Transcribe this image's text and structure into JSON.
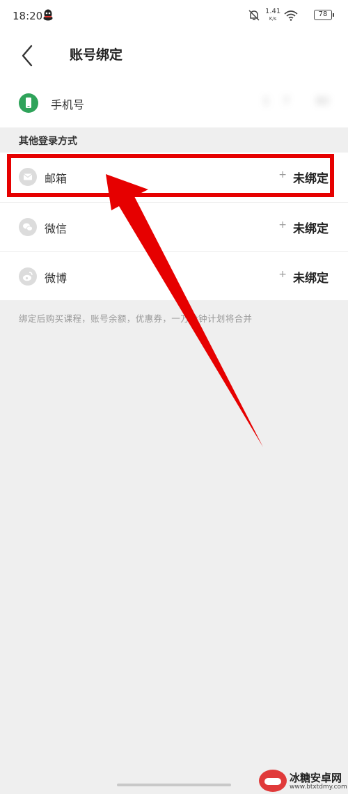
{
  "status_bar": {
    "time": "18:20",
    "net_speed": "1.41",
    "net_unit": "K/s",
    "battery": "78"
  },
  "header": {
    "title": "账号绑定"
  },
  "phone": {
    "label": "手机号",
    "value": "1    7        80"
  },
  "section": {
    "title": "其他登录方式"
  },
  "accounts": [
    {
      "label": "邮箱",
      "plus": "+",
      "status": "未绑定"
    },
    {
      "label": "微信",
      "plus": "+",
      "status": "未绑定"
    },
    {
      "label": "微博",
      "plus": "+",
      "status": "未绑定"
    }
  ],
  "note": "绑定后购买课程，账号余额，优惠券，一万分钟计划将合并",
  "watermark": {
    "title": "冰糖安卓网",
    "url": "www.btxtdmy.com"
  },
  "colors": {
    "highlight": "#e60000",
    "phone_icon": "#2fa35a",
    "page_bg": "#efefef"
  },
  "icons": {
    "back": "chevron-left-icon",
    "phone": "phone-icon",
    "email": "mail-icon",
    "wechat": "wechat-icon",
    "weibo": "weibo-icon"
  }
}
